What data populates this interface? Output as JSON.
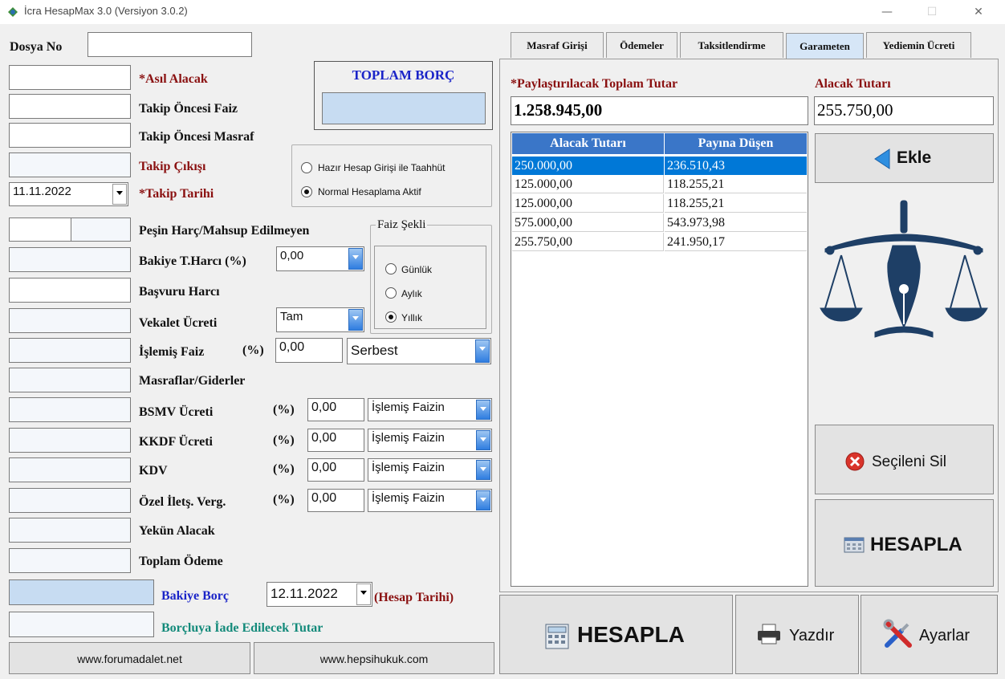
{
  "window": {
    "title": "İcra HesapMax 3.0 (Versiyon 3.0.2)"
  },
  "left": {
    "dosya_no_label": "Dosya No",
    "toplam_borc_label": "TOPLAM BORÇ",
    "asil_alacak": "*Asıl Alacak",
    "takip_oncesi_faiz": "Takip Öncesi Faiz",
    "takip_oncesi_masraf": "Takip Öncesi Masraf",
    "takip_cikisi": "Takip Çıkışı",
    "takip_tarihi_label": "*Takip Tarihi",
    "takip_tarihi_value": "11.11.2022",
    "pesin_harc": "Peşin Harç/Mahsup Edilmeyen",
    "bakiye_harc": "Bakiye T.Harcı (%)",
    "bakiye_harc_value": "0,00",
    "basvuru_harci": "Başvuru Harcı",
    "vekalet_ucreti": "Vekalet Ücreti",
    "vekalet_value": "Tam",
    "islemis_faiz": "İşlemiş Faiz",
    "islemis_faiz_pct": "(%)",
    "islemis_faiz_value": "0,00",
    "islemis_faiz_type": "Serbest",
    "masraflar": "Masraflar/Giderler",
    "bsmv": "BSMV Ücreti",
    "kkdf": "KKDF Ücreti",
    "kdv": "KDV",
    "ozel": "Özel İletş. Verg.",
    "pct": "(%)",
    "tax_value": "0,00",
    "tax_base": "İşlemiş Faizin",
    "yekun": "Yekün Alacak",
    "toplam_odeme": "Toplam Ödeme",
    "bakiye_borc": "Bakiye Borç",
    "hesap_tarihi_value": "12.11.2022",
    "hesap_tarihi_label": "(Hesap Tarihi)",
    "iade": "Borçluya İade Edilecek Tutar",
    "link1": "www.forumadalet.net",
    "link2": "www.hepsihukuk.com"
  },
  "mode_group": {
    "option1": "Hazır Hesap Girişi ile Taahhüt",
    "option2": "Normal Hesaplama Aktif",
    "selected": "option2"
  },
  "faiz_group": {
    "title": "Faiz Şekli",
    "option1": "Günlük",
    "option2": "Aylık",
    "option3": "Yıllık",
    "selected": "option3"
  },
  "tabs": [
    {
      "label": "Masraf Girişi"
    },
    {
      "label": "Ödemeler"
    },
    {
      "label": "Taksitlendirme"
    },
    {
      "label": "Garameten",
      "active": true
    },
    {
      "label": "Yediemin Ücreti"
    }
  ],
  "garameten": {
    "total_label": "*Paylaştırılacak Toplam Tutar",
    "total_value": "1.258.945,00",
    "alacak_label": "Alacak Tutarı",
    "alacak_value": "255.750,00",
    "table_headers": [
      "Alacak Tutarı",
      "Payına Düşen"
    ],
    "rows": [
      [
        "250.000,00",
        "236.510,43"
      ],
      [
        "125.000,00",
        "118.255,21"
      ],
      [
        "125.000,00",
        "118.255,21"
      ],
      [
        "575.000,00",
        "543.973,98"
      ],
      [
        "255.750,00",
        "241.950,17"
      ]
    ],
    "add_button": "Ekle",
    "delete_button": "Seçileni Sil",
    "calc_button": "HESAPLA"
  },
  "bottom": {
    "calc_button": "HESAPLA",
    "print_button": "Yazdır",
    "settings_button": "Ayarlar"
  },
  "colors": {
    "accent": "#3a76c8",
    "selected_row": "#0078d7",
    "label_red": "#8a1010"
  }
}
